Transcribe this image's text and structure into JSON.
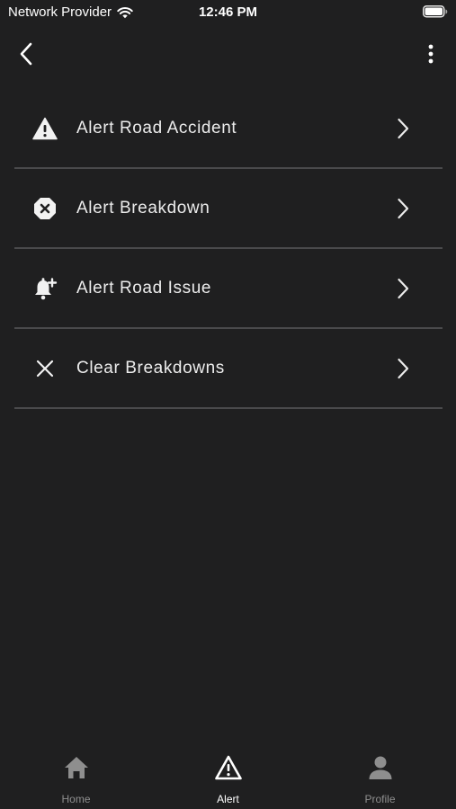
{
  "status_bar": {
    "carrier": "Network Provider",
    "time": "12:46 PM"
  },
  "top_bar": {
    "back_icon": "chevron-left-icon",
    "more_icon": "more-vertical-icon"
  },
  "alerts": [
    {
      "label": "Alert Road Accident",
      "icon": "warning-triangle-icon"
    },
    {
      "label": "Alert Breakdown",
      "icon": "x-octagon-icon"
    },
    {
      "label": "Alert Road Issue",
      "icon": "bell-plus-icon"
    },
    {
      "label": "Clear Breakdowns",
      "icon": "close-icon"
    }
  ],
  "tabs": [
    {
      "label": "Home",
      "icon": "home-icon",
      "active": false
    },
    {
      "label": "Alert",
      "icon": "warning-triangle-icon",
      "active": true
    },
    {
      "label": "Profile",
      "icon": "person-icon",
      "active": false
    }
  ],
  "colors": {
    "background": "#1f1f20",
    "divider": "#4a4a4c",
    "active_tab": "#ffffff",
    "inactive_tab": "#8e8e8e"
  }
}
